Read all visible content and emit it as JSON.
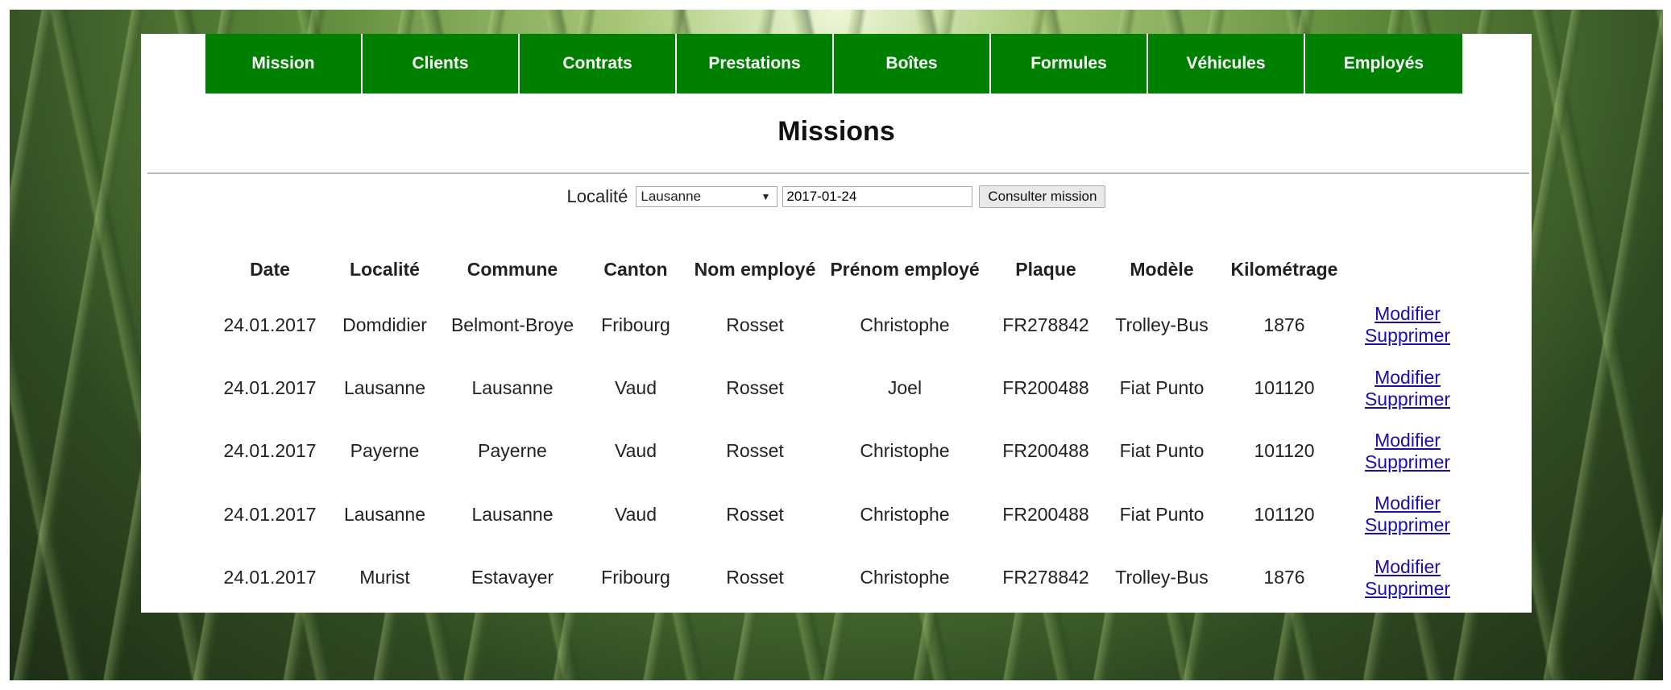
{
  "nav": {
    "items": [
      "Mission",
      "Clients",
      "Contrats",
      "Prestations",
      "Boîtes",
      "Formules",
      "Véhicules",
      "Employés"
    ]
  },
  "page_title": "Missions",
  "filter": {
    "label": "Localité",
    "selected_locality": "Lausanne",
    "date_value": "2017-01-24",
    "submit_label": "Consulter mission"
  },
  "table": {
    "headers": [
      "Date",
      "Localité",
      "Commune",
      "Canton",
      "Nom employé",
      "Prénom employé",
      "Plaque",
      "Modèle",
      "Kilométrage",
      ""
    ],
    "rows": [
      {
        "date": "24.01.2017",
        "localite": "Domdidier",
        "commune": "Belmont-Broye",
        "canton": "Fribourg",
        "nom": "Rosset",
        "prenom": "Christophe",
        "plaque": "FR278842",
        "modele": "Trolley-Bus",
        "km": "1876",
        "modify": "Modifier",
        "delete": "Supprimer"
      },
      {
        "date": "24.01.2017",
        "localite": "Lausanne",
        "commune": "Lausanne",
        "canton": "Vaud",
        "nom": "Rosset",
        "prenom": "Joel",
        "plaque": "FR200488",
        "modele": "Fiat Punto",
        "km": "101120",
        "modify": "Modifier",
        "delete": "Supprimer"
      },
      {
        "date": "24.01.2017",
        "localite": "Payerne",
        "commune": "Payerne",
        "canton": "Vaud",
        "nom": "Rosset",
        "prenom": "Christophe",
        "plaque": "FR200488",
        "modele": "Fiat Punto",
        "km": "101120",
        "modify": "Modifier",
        "delete": "Supprimer"
      },
      {
        "date": "24.01.2017",
        "localite": "Lausanne",
        "commune": "Lausanne",
        "canton": "Vaud",
        "nom": "Rosset",
        "prenom": "Christophe",
        "plaque": "FR200488",
        "modele": "Fiat Punto",
        "km": "101120",
        "modify": "Modifier",
        "delete": "Supprimer"
      },
      {
        "date": "24.01.2017",
        "localite": "Murist",
        "commune": "Estavayer",
        "canton": "Fribourg",
        "nom": "Rosset",
        "prenom": "Christophe",
        "plaque": "FR278842",
        "modele": "Trolley-Bus",
        "km": "1876",
        "modify": "Modifier",
        "delete": "Supprimer"
      }
    ]
  }
}
